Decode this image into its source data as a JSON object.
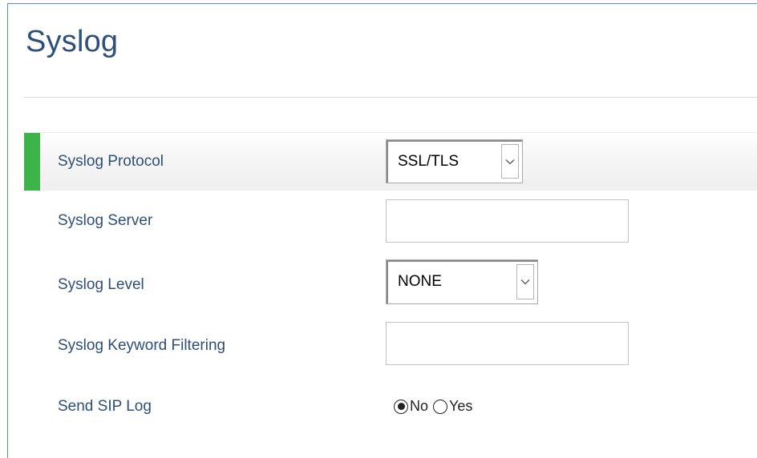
{
  "page": {
    "title": "Syslog"
  },
  "fields": {
    "protocol": {
      "label": "Syslog Protocol",
      "value": "SSL/TLS"
    },
    "server": {
      "label": "Syslog Server",
      "value": ""
    },
    "level": {
      "label": "Syslog Level",
      "value": "NONE"
    },
    "keyword": {
      "label": "Syslog Keyword Filtering",
      "value": ""
    },
    "sip_log": {
      "label": "Send SIP Log",
      "options": [
        "No",
        "Yes"
      ],
      "selected": "No"
    }
  },
  "colors": {
    "title": "#2d4f7c",
    "label": "#2d4f7c",
    "active_marker": "#3cb44a",
    "frame_border": "#5b8fc7"
  },
  "icons": {
    "dropdown": "chevron-down-icon"
  }
}
